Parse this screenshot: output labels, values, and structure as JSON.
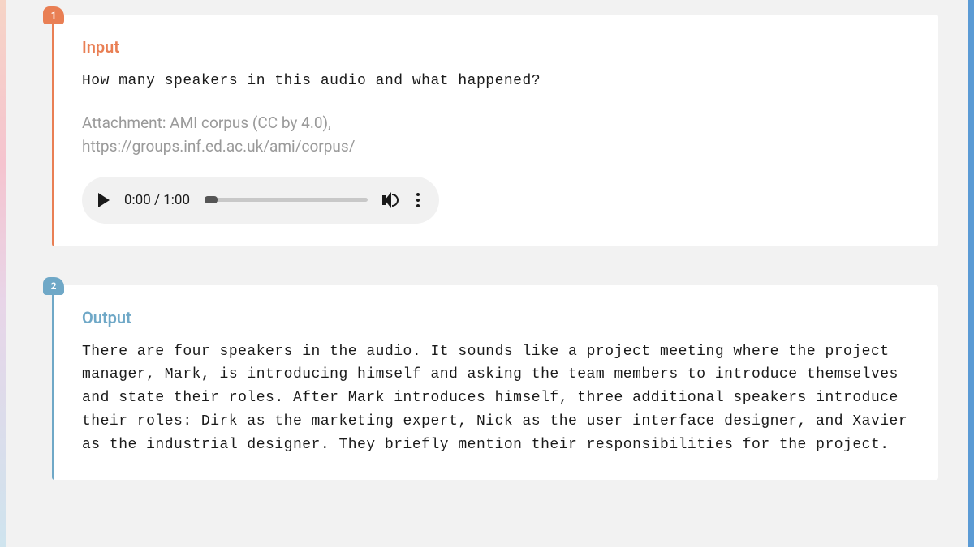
{
  "blocks": {
    "input": {
      "badge": "1",
      "title": "Input",
      "prompt": "How many speakers in this audio and what happened?",
      "attachment_line1": "Attachment: AMI corpus (CC by 4.0),",
      "attachment_line2": "https://groups.inf.ed.ac.uk/ami/corpus/",
      "audio": {
        "current_time": "0:00",
        "duration": "1:00",
        "time_display": "0:00 / 1:00"
      }
    },
    "output": {
      "badge": "2",
      "title": "Output",
      "text": "There are four speakers in the audio. It sounds like a project meeting where the project manager, Mark, is introducing himself and asking the team members to introduce themselves and state their roles. After Mark introduces himself, three additional speakers introduce their roles: Dirk as the marketing expert, Nick as the user interface designer, and Xavier as the industrial designer. They briefly mention their responsibilities for the project."
    }
  },
  "colors": {
    "input_accent": "#e97f54",
    "output_accent": "#6fa8c7"
  }
}
